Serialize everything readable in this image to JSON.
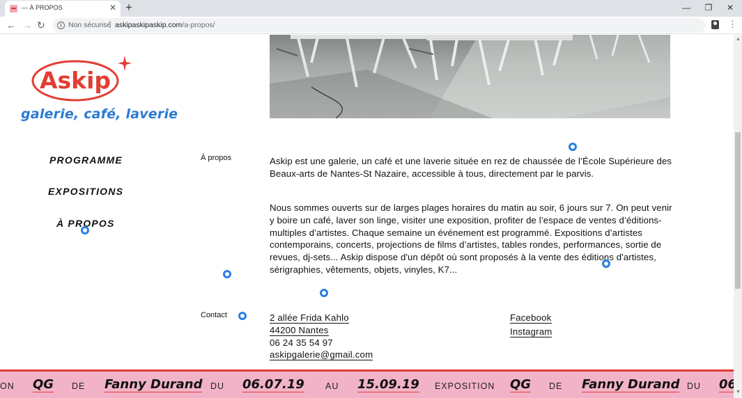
{
  "browser": {
    "tab_title": "— À PROPOS",
    "tab_close": "✕",
    "new_tab": "+",
    "win_min": "—",
    "win_max": "❐",
    "win_close": "✕",
    "back": "←",
    "forward": "→",
    "reload": "↻",
    "security_text": "Non sécurisé",
    "separator": "|",
    "url_host": "askipaskipaskip.com",
    "url_path": "/a-propos/",
    "menu": "⋮"
  },
  "logo": {
    "name": "Askip",
    "tagline": "galerie, café, laverie",
    "accent_color": "#e23d33",
    "tagline_color": "#2a7ad3"
  },
  "nav": {
    "items": [
      "PROGRAMME",
      "EXPOSITIONS",
      "À PROPOS"
    ]
  },
  "about": {
    "label": "À propos",
    "paragraphs": [
      "Askip est une galerie, un café et une laverie située en rez de chaussée de l’École Supérieure des Beaux-arts de Nantes-St Nazaire, accessible à tous, directement par le parvis.",
      "Nous sommes ouverts sur de larges plages horaires du matin au soir, 6 jours sur 7. On peut venir y boire un café, laver son linge, visiter une exposition, profiter de l’espace de ventes d’éditions-multiples d’artistes. Chaque semaine un événement est programmé. Expositions d’artistes contemporains, concerts, projections de films d’artistes, tables rondes, performances, sortie de revues, dj-sets... Askip dispose d'un dépôt où sont proposés à la vente des éditions d'artistes, sérigraphies, vêtements, objets, vinyles, K7..."
    ]
  },
  "contact": {
    "label": "Contact",
    "address_line1": "2 allée Frida Kahlo",
    "address_line2": "44200 Nantes",
    "phone": "06 24 35 54 97",
    "email": "askipgalerie@gmail.com",
    "facebook": "Facebook",
    "instagram": "Instagram"
  },
  "ticker": {
    "segments": [
      {
        "text": "ON",
        "style": "word"
      },
      {
        "text": "QG",
        "style": "big"
      },
      {
        "text": "DE",
        "style": "word"
      },
      {
        "text": "Fanny Durand",
        "style": "big"
      },
      {
        "text": "DU",
        "style": "word"
      },
      {
        "text": "06.07.19",
        "style": "big"
      },
      {
        "text": "AU",
        "style": "word"
      },
      {
        "text": "15.09.19",
        "style": "big"
      },
      {
        "text": "EXPOSITION",
        "style": "word"
      },
      {
        "text": "QG",
        "style": "big"
      },
      {
        "text": "DE",
        "style": "word"
      },
      {
        "text": "Fanny Durand",
        "style": "big"
      },
      {
        "text": "DU",
        "style": "word"
      },
      {
        "text": "06",
        "style": "big"
      }
    ],
    "background": "#f2b3c8",
    "border_color": "#e23d33"
  }
}
